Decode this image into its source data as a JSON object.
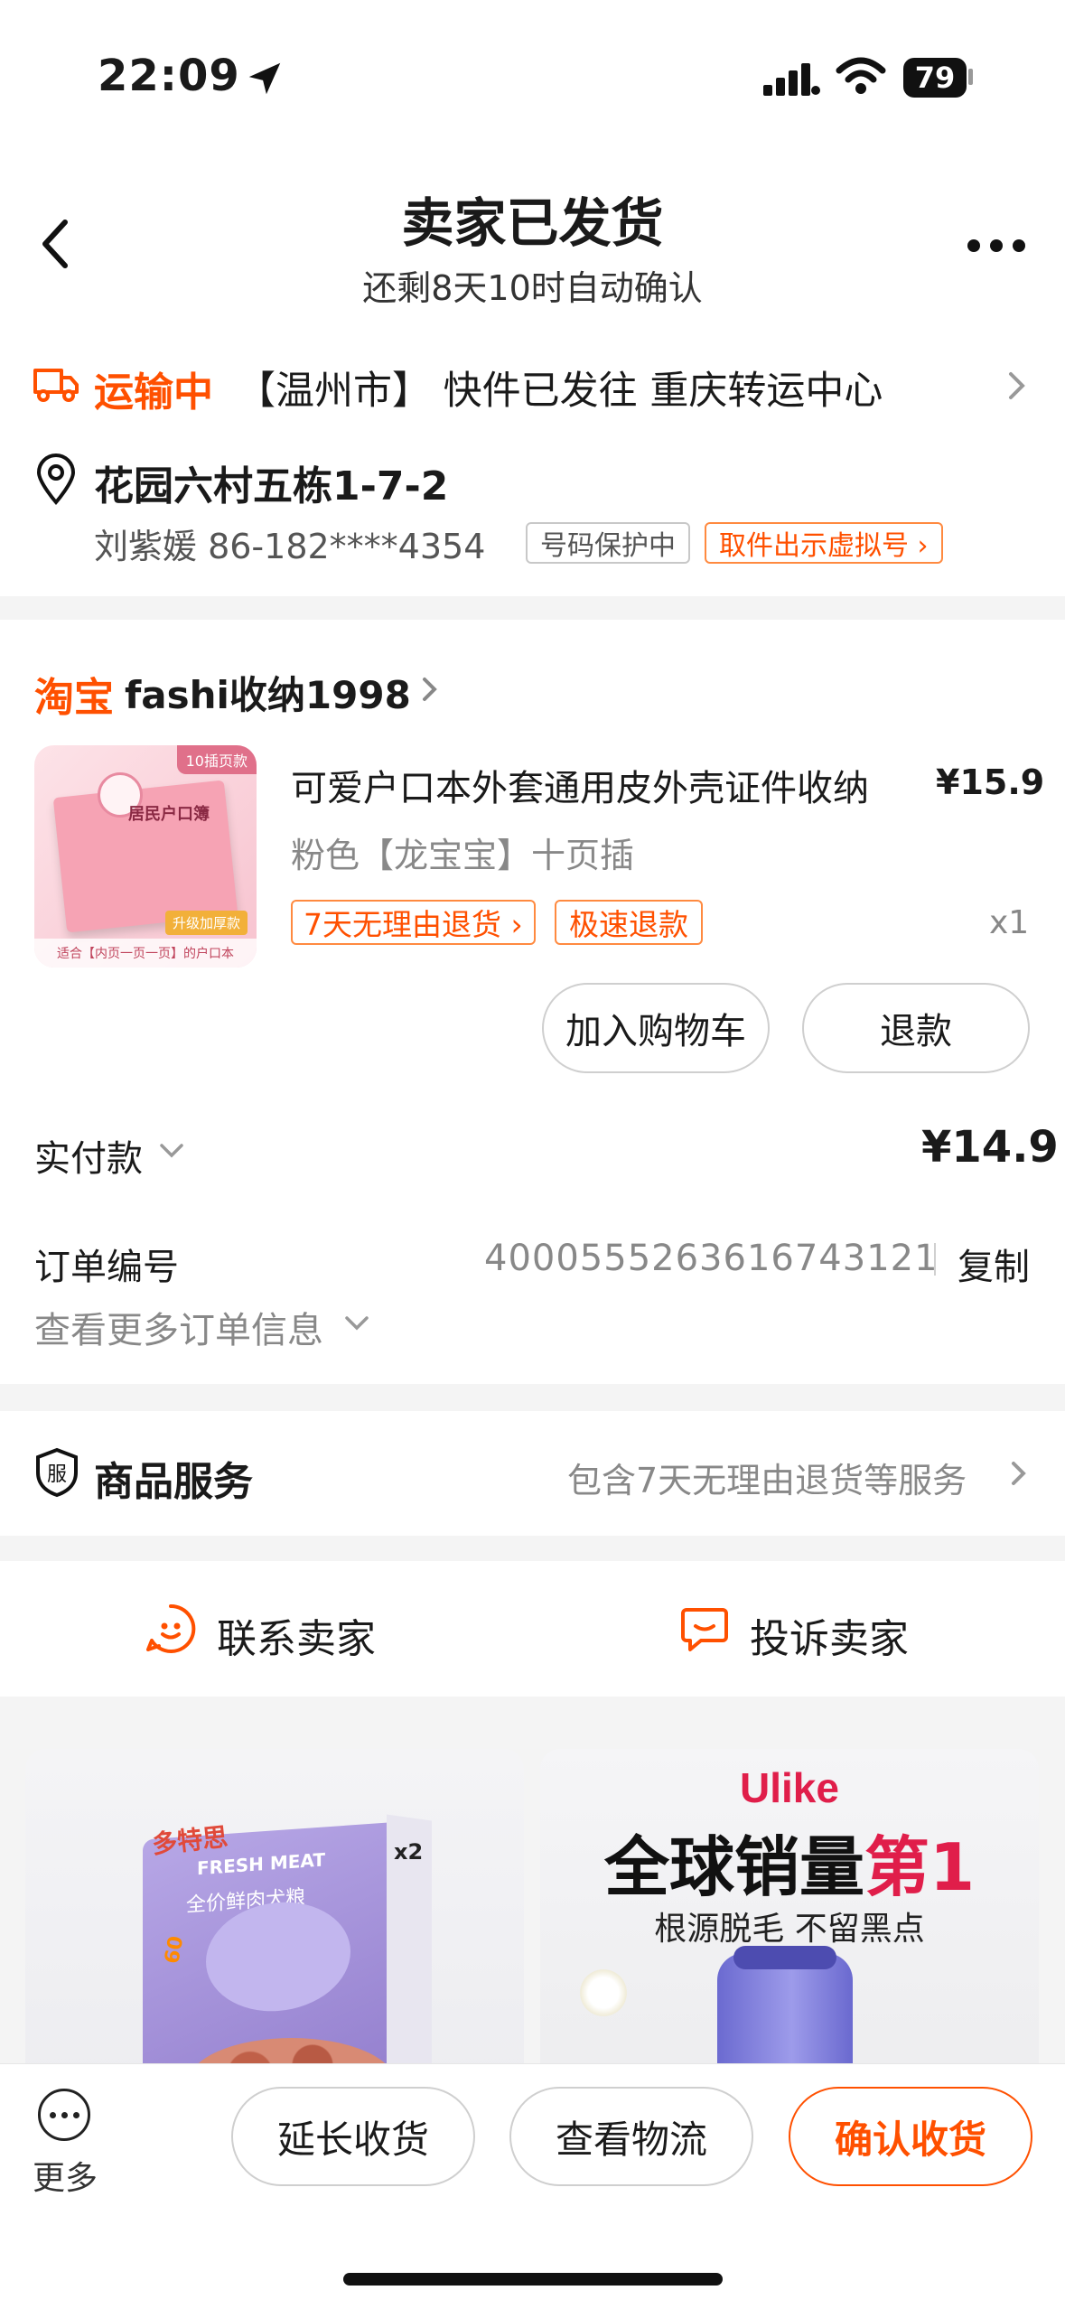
{
  "status_bar": {
    "time": "22:09",
    "battery": "79"
  },
  "header": {
    "title": "卖家已发货",
    "subtitle": "还剩8天10时自动确认"
  },
  "logistics": {
    "status": "运输中",
    "detail": "【温州市】 快件已发往 重庆转运中心"
  },
  "address": {
    "line": "花园六村五栋1-7-2",
    "contact": "刘紫媛 86-182****4354",
    "tag_protect": "号码保护中",
    "tag_virtual": "取件出示虚拟号 ›"
  },
  "shop": {
    "platform": "淘宝",
    "name": "fashi收纳1998"
  },
  "product": {
    "title": "可爱户口本外套通用皮外壳证件收纳",
    "price": "¥15.9",
    "sku": "粉色【龙宝宝】十页插",
    "tag_return": "7天无理由退货 ›",
    "tag_refund": "极速退款",
    "qty": "x1",
    "thumb_top": "10插页款",
    "thumb_label": "居民户口簿",
    "thumb_badge": "升级加厚款",
    "thumb_foot": "适合【内页一页一页】的户口本"
  },
  "actions": {
    "add_cart": "加入购物车",
    "refund": "退款"
  },
  "payment": {
    "label": "实付款",
    "amount": "¥14.9"
  },
  "order": {
    "label": "订单编号",
    "number": "4000555263616743121",
    "copy": "复制",
    "more": "查看更多订单信息"
  },
  "service": {
    "label": "商品服务",
    "desc": "包含7天无理由退货等服务"
  },
  "contact": {
    "seller": "联系卖家",
    "complain": "投诉卖家"
  },
  "recommend": {
    "left": {
      "brand": "多特思",
      "text1": "FRESH MEAT",
      "text2": "全价鲜肉犬粮",
      "badge": "60",
      "x2": "x2"
    },
    "right": {
      "logo": "Ulike",
      "head_black": "全球销量",
      "head_red": "第1",
      "sub": "根源脱毛 不留黑点"
    }
  },
  "bottom_bar": {
    "more": "更多",
    "extend": "延长收货",
    "track": "查看物流",
    "confirm": "确认收货"
  },
  "colors": {
    "accent": "#ff5000",
    "text": "#1a1a1a",
    "muted": "#888888"
  },
  "icons": [
    "location-arrow-icon",
    "signal-icon",
    "wifi-icon",
    "battery-icon",
    "back-icon",
    "more-dots-icon",
    "truck-icon",
    "chevron-right-icon",
    "location-pin-icon",
    "chevron-down-icon",
    "service-shield-icon",
    "seller-face-icon",
    "complain-chat-icon",
    "more-circle-icon"
  ]
}
